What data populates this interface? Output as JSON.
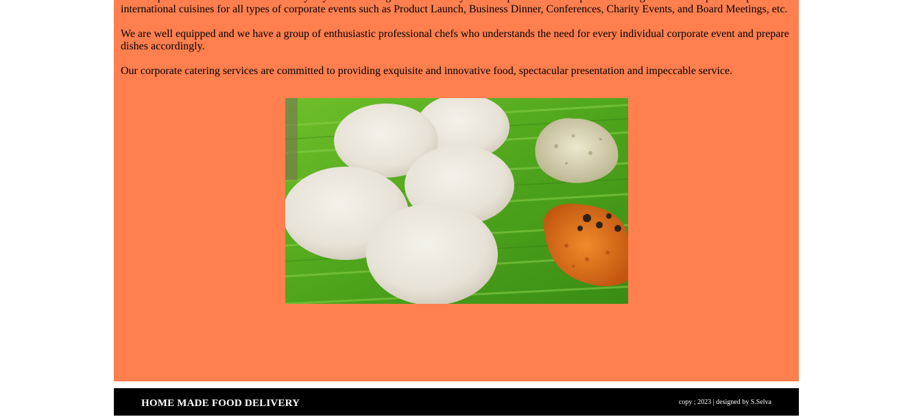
{
  "content": {
    "paragraphs": [
      "We will provide office lunch on time every day and we change our menu daily. We are specialized in corporate catering services. We provide specialized international cuisines for all types of corporate events such as Product Launch, Business Dinner, Conferences, Charity Events, and Board Meetings, etc.",
      "We are well equipped and we have a group of enthusiastic professional chefs who understands the need for every individual corporate event and prepare dishes accordingly.",
      "Our corporate catering services are committed to providing exquisite and innovative food, spectacular presentation and impeccable service."
    ],
    "image": {
      "subject": "idli-with-chutney-on-banana-leaf"
    }
  },
  "footer": {
    "brand": "HOME MADE FOOD DELIVERY",
    "credit": "copy ; 2023 | designed by S.Selva"
  },
  "colors": {
    "content_background": "#ff7f4e",
    "footer_background": "#000000",
    "footer_text": "#ffffff"
  }
}
